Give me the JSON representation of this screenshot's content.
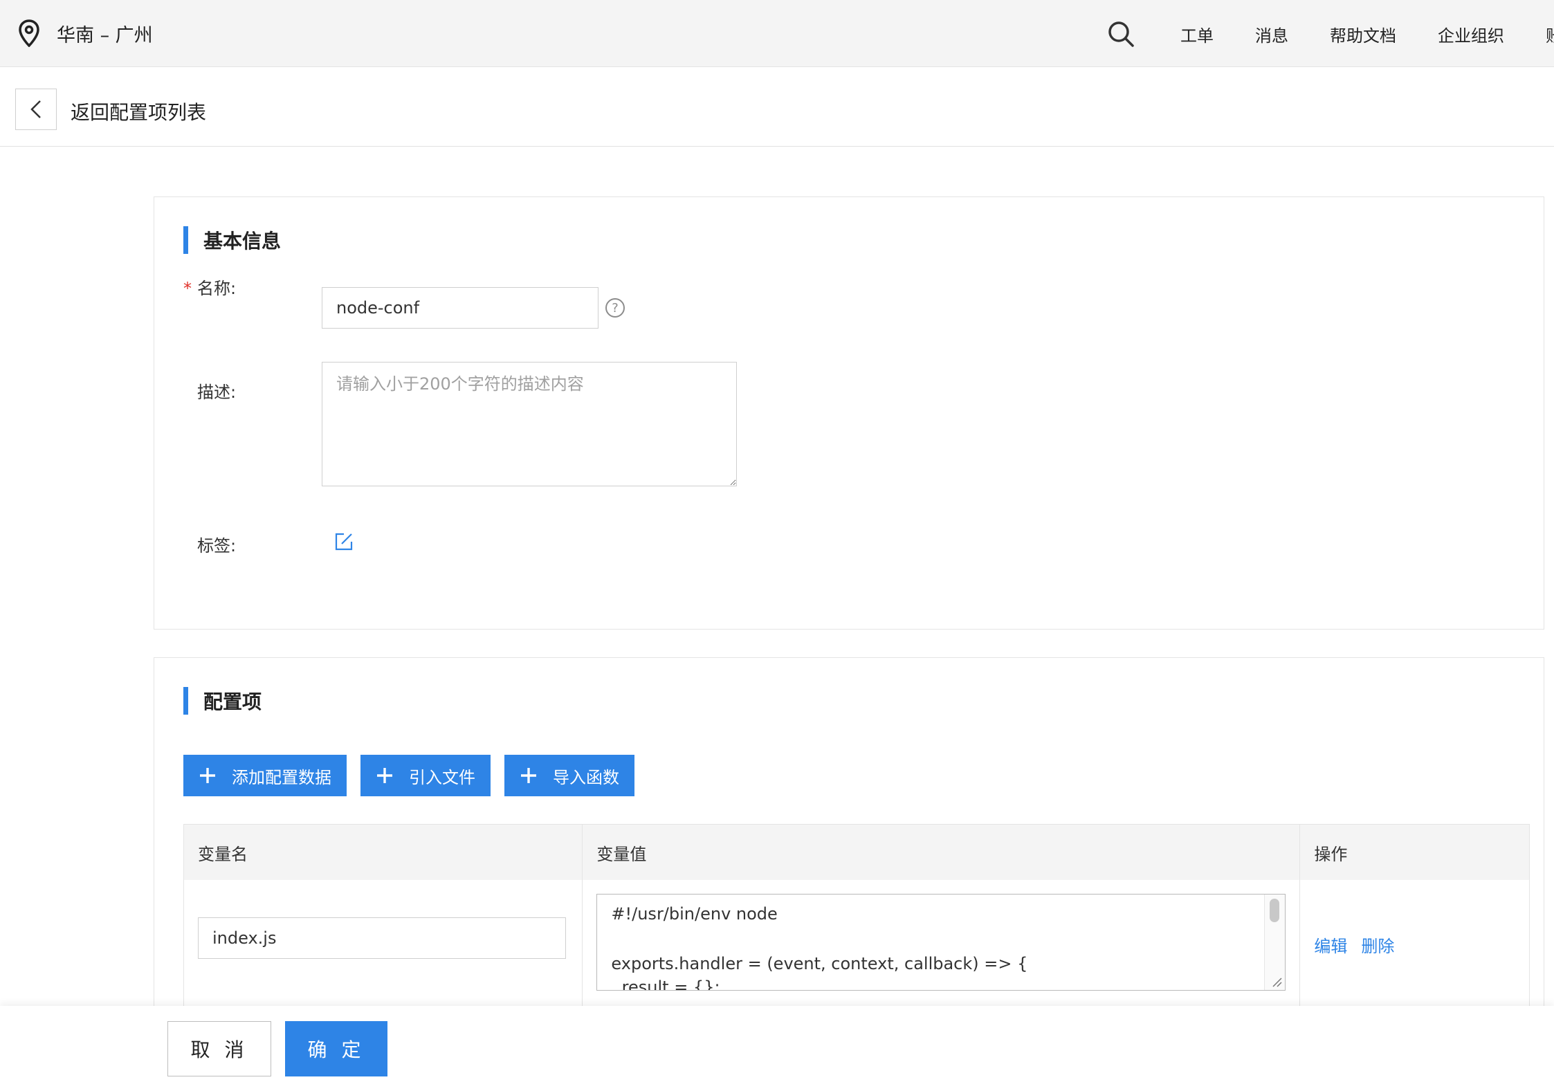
{
  "topbar": {
    "region": "华南 – 广州",
    "icons": {
      "location": "map-pin-icon",
      "search": "search-icon"
    },
    "nav": [
      "工单",
      "消息",
      "帮助文档",
      "企业组织",
      "账"
    ]
  },
  "subheader": {
    "back_icon": "chevron-left-icon",
    "back_text": "返回配置项列表"
  },
  "basic": {
    "title": "基本信息",
    "name_required_mark": "*",
    "name_label": "名称:",
    "name_value": "node-conf",
    "help_glyph": "?",
    "desc_label": "描述:",
    "desc_placeholder": "请输入小于200个字符的描述内容",
    "tags_label": "标签:",
    "tags_edit_icon": "edit-icon"
  },
  "config": {
    "title": "配置项",
    "buttons": {
      "add": "添加配置数据",
      "import_file": "引入文件",
      "import_func": "导入函数"
    },
    "table": {
      "headers": [
        "变量名",
        "变量值",
        "操作"
      ],
      "rows": [
        {
          "name": "index.js",
          "value_lines": [
            "#!/usr/bin/env node",
            "",
            "exports.handler = (event, context, callback) => {",
            "  result = {};"
          ],
          "ops": [
            "编辑",
            "删除"
          ]
        }
      ]
    }
  },
  "footer": {
    "cancel": "取 消",
    "ok": "确 定"
  },
  "colors": {
    "primary": "#2e84e6",
    "required": "#e0322a",
    "topbar_bg": "#f4f4f4"
  }
}
